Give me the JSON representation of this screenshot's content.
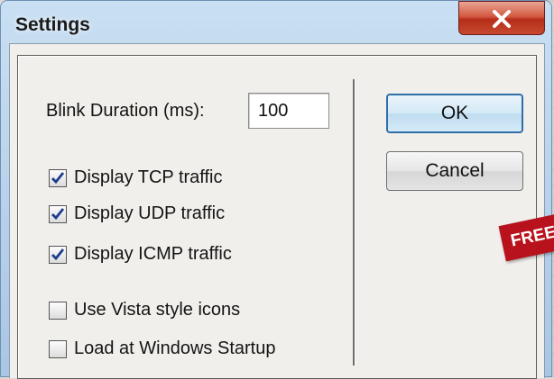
{
  "window": {
    "title": "Settings",
    "close_icon": "close-icon"
  },
  "settings": {
    "blink_label": "Blink Duration (ms):",
    "blink_value": "100",
    "checkboxes": [
      {
        "label": "Display TCP traffic",
        "checked": true
      },
      {
        "label": "Display UDP traffic",
        "checked": true
      },
      {
        "label": "Display ICMP traffic",
        "checked": true
      },
      {
        "label": "Use Vista style icons",
        "checked": false
      },
      {
        "label": "Load at Windows Startup",
        "checked": false
      }
    ]
  },
  "buttons": {
    "ok": "OK",
    "cancel": "Cancel"
  },
  "badge": {
    "text": "FREE",
    "color": "#b8121c"
  }
}
